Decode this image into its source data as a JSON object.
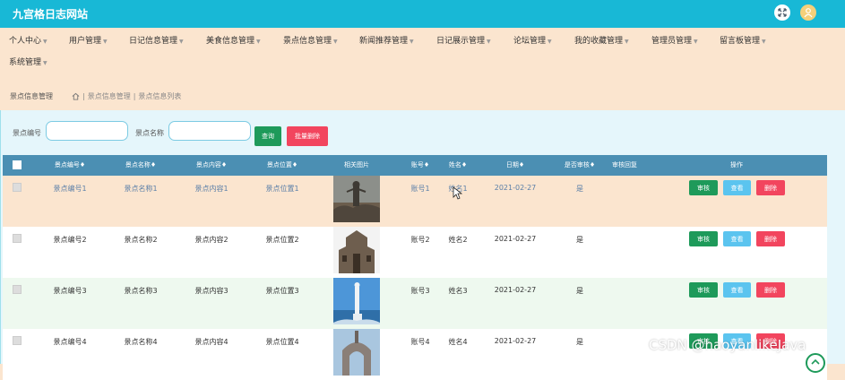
{
  "header": {
    "title": "九宫格日志网站",
    "fullscreen_icon": "expand-icon",
    "user_icon": "user-avatar-icon",
    "colors": {
      "bar": "#18b8d6",
      "accent": "#1e9a5a"
    }
  },
  "nav": {
    "items": [
      {
        "label": "个人中心"
      },
      {
        "label": "用户管理"
      },
      {
        "label": "日记信息管理"
      },
      {
        "label": "美食信息管理"
      },
      {
        "label": "景点信息管理"
      },
      {
        "label": "新闻推荐管理"
      },
      {
        "label": "日记展示管理"
      },
      {
        "label": "论坛管理"
      },
      {
        "label": "我的收藏管理"
      },
      {
        "label": "管理员管理"
      },
      {
        "label": "留言板管理"
      },
      {
        "label": "系统管理"
      }
    ]
  },
  "breadcrumb": {
    "title": "景点信息管理",
    "home_icon": "home-icon",
    "path": [
      "景点信息管理",
      "景点信息列表"
    ],
    "separator": "|"
  },
  "search": {
    "field1_label": "景点编号",
    "field1_value": "",
    "field2_label": "景点名称",
    "field2_value": "",
    "search_button": "查询",
    "batch_delete_button": "批量删除"
  },
  "table": {
    "headers": [
      "景点编号",
      "景点名称",
      "景点内容",
      "景点位置",
      "相关图片",
      "账号",
      "姓名",
      "日期",
      "是否审核",
      "审核回复",
      "操作"
    ],
    "sortable": [
      true,
      true,
      true,
      true,
      false,
      true,
      true,
      true,
      true,
      false,
      false
    ],
    "sort_glyph": "♦",
    "actions": {
      "audit": "审核",
      "view": "查看",
      "delete": "删除"
    },
    "rows": [
      {
        "code": "景点编号1",
        "name": "景点名称1",
        "content": "景点内容1",
        "location": "景点位置1",
        "image": "statue-on-rocks",
        "account": "账号1",
        "person": "姓名1",
        "date": "2021-02-27",
        "reviewed": "是",
        "reply": ""
      },
      {
        "code": "景点编号2",
        "name": "景点名称2",
        "content": "景点内容2",
        "location": "景点位置2",
        "image": "ancient-gate",
        "account": "账号2",
        "person": "姓名2",
        "date": "2021-02-27",
        "reviewed": "是",
        "reply": ""
      },
      {
        "code": "景点编号3",
        "name": "景点名称3",
        "content": "景点内容3",
        "location": "景点位置3",
        "image": "white-statue-sea",
        "account": "账号3",
        "person": "姓名3",
        "date": "2021-02-27",
        "reviewed": "是",
        "reply": ""
      },
      {
        "code": "景点编号4",
        "name": "景点名称4",
        "content": "景点内容4",
        "location": "景点位置4",
        "image": "arch-monument",
        "account": "账号4",
        "person": "姓名4",
        "date": "2021-02-27",
        "reviewed": "是",
        "reply": ""
      }
    ]
  },
  "watermark": "CSDN @haoyanlikeJava",
  "scroll_top_icon": "scroll-up-icon"
}
